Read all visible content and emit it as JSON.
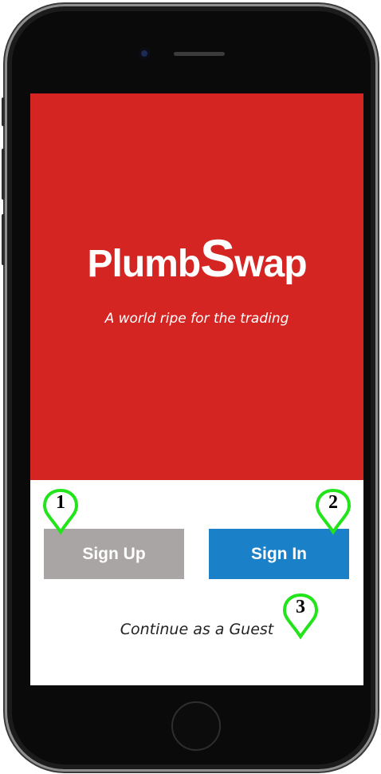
{
  "app": {
    "logo_part1": "Plumb",
    "logo_big": "S",
    "logo_part2": "wap",
    "tagline": "A world ripe for the trading"
  },
  "actions": {
    "sign_up": "Sign Up",
    "sign_in": "Sign In",
    "guest": "Continue as a Guest"
  },
  "markers": [
    "1",
    "2",
    "3"
  ],
  "colors": {
    "brand_red": "#d42523",
    "sign_up_gray": "#aaa5a5",
    "sign_in_blue": "#1a80c8",
    "marker_green": "#22e41a"
  }
}
